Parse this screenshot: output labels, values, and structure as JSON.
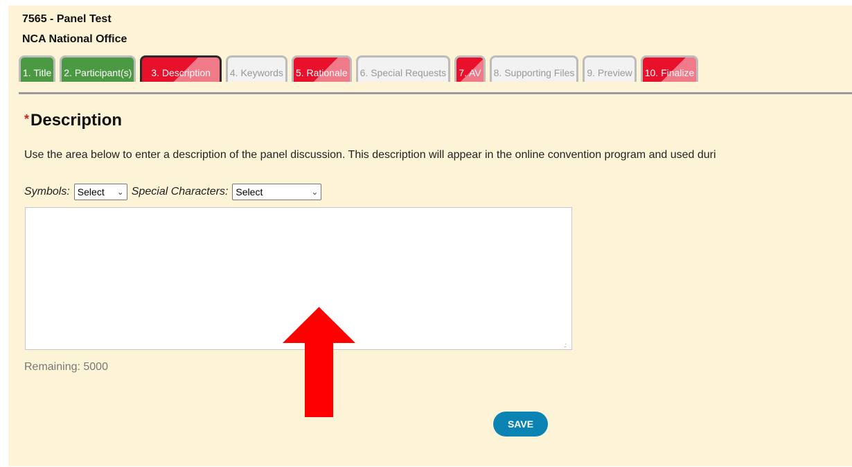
{
  "header": {
    "panel_id": "7565 - Panel Test",
    "organization": "NCA National Office"
  },
  "tabs": [
    {
      "label": "1. Title",
      "status": "complete"
    },
    {
      "label": "2. Participant(s)",
      "status": "complete"
    },
    {
      "label": "3. Description",
      "status": "incomplete",
      "active": true
    },
    {
      "label": "4. Keywords",
      "status": "optional"
    },
    {
      "label": "5. Rationale",
      "status": "incomplete"
    },
    {
      "label": "6. Special Requests",
      "status": "optional"
    },
    {
      "label": "7. AV",
      "status": "incomplete"
    },
    {
      "label": "8. Supporting Files",
      "status": "optional"
    },
    {
      "label": "9. Preview",
      "status": "optional"
    },
    {
      "label": "10. Finalize",
      "status": "incomplete"
    }
  ],
  "section": {
    "required_marker": "*",
    "title": "Description",
    "instructions": "Use the area below to enter a description of the panel discussion. This description will appear in the online convention program and used duri"
  },
  "toolbar": {
    "symbols_label": "Symbols:",
    "symbols_value": "Select",
    "special_chars_label": "Special Characters:",
    "special_chars_value": "Select"
  },
  "editor": {
    "value": "",
    "remaining_text": "Remaining: 5000"
  },
  "actions": {
    "save_label": "SAVE"
  },
  "colors": {
    "panel_bg": "#fdf3d6",
    "tab_complete": "#4b9a43",
    "tab_incomplete": "#e8102a",
    "save_button": "#0b84b4",
    "arrow": "#ff0000"
  },
  "icons": {
    "arrow": "up-arrow-icon",
    "chevron": "chevron-down-icon"
  }
}
